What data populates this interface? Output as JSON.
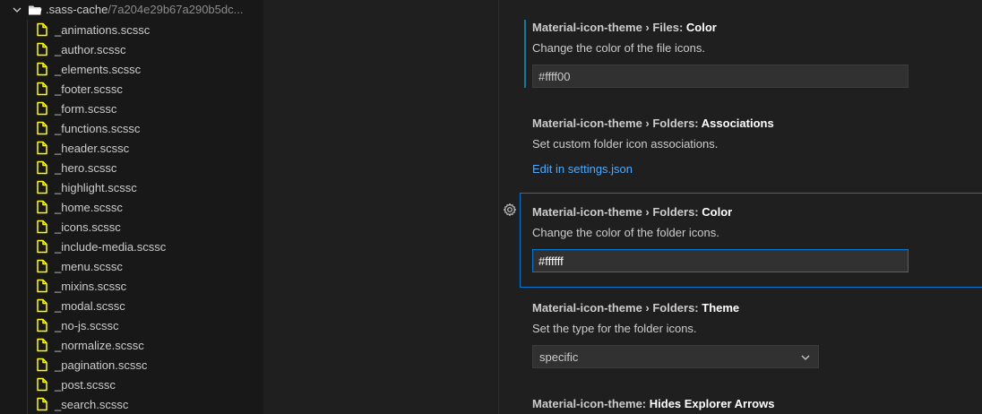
{
  "explorer": {
    "folder": {
      "name": ".sass-cache",
      "path": "/7a204e29b67a290b5dc..."
    },
    "files": [
      "_animations.scssc",
      "_author.scssc",
      "_elements.scssc",
      "_footer.scssc",
      "_form.scssc",
      "_functions.scssc",
      "_header.scssc",
      "_hero.scssc",
      "_highlight.scssc",
      "_home.scssc",
      "_icons.scssc",
      "_include-media.scssc",
      "_menu.scssc",
      "_mixins.scssc",
      "_modal.scssc",
      "_no-js.scssc",
      "_normalize.scssc",
      "_pagination.scssc",
      "_post.scssc",
      "_search.scssc"
    ],
    "file_icon_color": "#ffff00",
    "folder_icon_color": "#ffffff"
  },
  "settings": {
    "files_color": {
      "category": "Material-icon-theme › Files: ",
      "key": "Color",
      "description": "Change the color of the file icons.",
      "value": "#ffff00"
    },
    "folders_associations": {
      "category": "Material-icon-theme › Folders: ",
      "key": "Associations",
      "description": "Set custom folder icon associations.",
      "link": "Edit in settings.json"
    },
    "folders_color": {
      "category": "Material-icon-theme › Folders: ",
      "key": "Color",
      "description": "Change the color of the folder icons.",
      "value": "#ffffff"
    },
    "folders_theme": {
      "category": "Material-icon-theme › Folders: ",
      "key": "Theme",
      "description": "Set the type for the folder icons.",
      "selected": "specific"
    },
    "hides_explorer_arrows": {
      "category": "Material-icon-theme: ",
      "key": "Hides Explorer Arrows"
    }
  },
  "icons": {
    "folder_chevron": "chevron-down-icon",
    "folder": "folder-open-icon",
    "file": "file-icon",
    "gear": "gear-icon",
    "select_chevron": "chevron-down-icon"
  },
  "colors": {
    "accent": "#0078d4",
    "link": "#4daafc",
    "modified_indicator": "#0c7d9d"
  }
}
